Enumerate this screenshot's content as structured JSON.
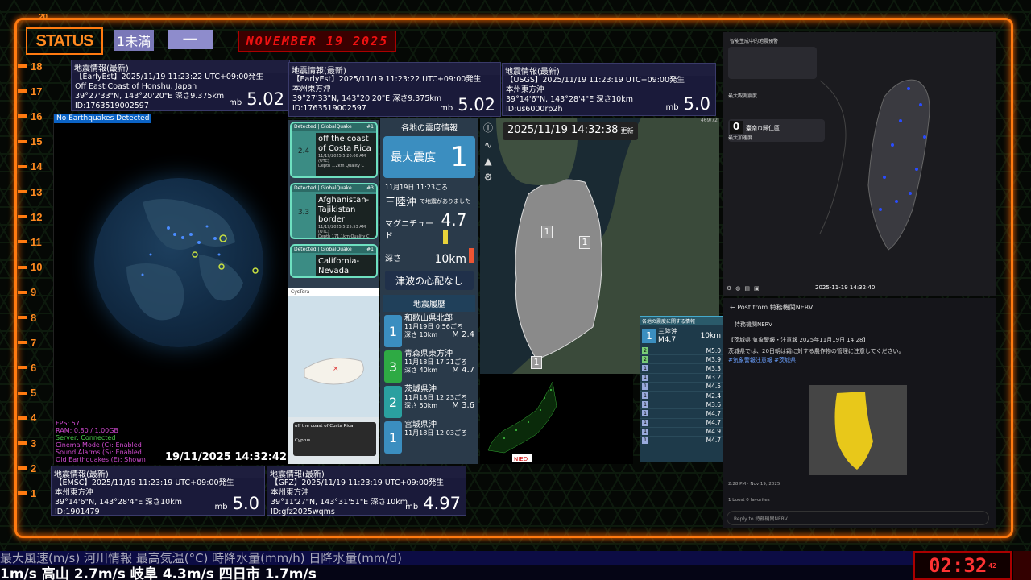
{
  "status": {
    "label": "STATUS",
    "badge_a": "1未満",
    "badge_b": "一",
    "date_banner": "NOVEMBER 19 2025"
  },
  "ruler": {
    "top_label": "20",
    "ticks": [
      "18",
      "17",
      "16",
      "15",
      "14",
      "13",
      "12",
      "11",
      "10",
      "9",
      "8",
      "7",
      "6",
      "5",
      "4",
      "3",
      "2",
      "1"
    ]
  },
  "cards": [
    {
      "id": "c1",
      "header": "地震情報(最新)",
      "l1": "【EarlyEst】2025/11/19 11:23:22 UTC+09:00発生",
      "l2": "Off East Coast of Honshu, Japan",
      "l3": "39°27'33\"N, 143°20'20\"E 深さ9.375km",
      "l4": "ID:1763519002597",
      "unit": "mb",
      "mag": "5.02"
    },
    {
      "id": "c2",
      "header": "地震情報(最新)",
      "l1": "【EarlyEst】2025/11/19 11:23:22 UTC+09:00発生",
      "l2": "本州東方沖",
      "l3": "39°27'33\"N, 143°20'20\"E 深さ9.375km",
      "l4": "ID:1763519002597",
      "unit": "mb",
      "mag": "5.02"
    },
    {
      "id": "c3",
      "header": "地震情報(最新)",
      "l1": "【USGS】2025/11/19 11:23:19 UTC+09:00発生",
      "l2": "本州東方沖",
      "l3": "39°14'6\"N, 143°28'4\"E 深さ10km",
      "l4": "ID:us6000rp2h",
      "unit": "mb",
      "mag": "5.0"
    },
    {
      "id": "c4",
      "header": "地震情報(最新)",
      "l1": "【EMSC】2025/11/19 11:23:19 UTC+09:00発生",
      "l2": "本州東方沖",
      "l3": "39°14'6\"N, 143°28'4\"E 深さ10km",
      "l4": "ID:1901479",
      "unit": "mb",
      "mag": "5.0"
    },
    {
      "id": "c5",
      "header": "地震情報(最新)",
      "l1": "【GFZ】2025/11/19 11:23:19 UTC+09:00発生",
      "l2": "本州東方沖",
      "l3": "39°11'27\"N, 143°31'51\"E 深さ10km",
      "l4": "ID:gfz2025wqms",
      "unit": "mb",
      "mag": "4.97"
    }
  ],
  "globe": {
    "no_eq": "No Earthquakes Detected",
    "clock": "19/11/2025 14:32:42",
    "stats": [
      "FPS: 57",
      "RAM: 0.80 / 1.00GB",
      "Server: Connected",
      "Cinema Mode (C): Enabled",
      "Sound Alarms (S): Enabled",
      "Old Earthquakes (E): Shown"
    ]
  },
  "globalquake": [
    {
      "tag": "Detected | GlobalQuake",
      "num": "#1",
      "name": "off the coast of Costa Rica",
      "mag": "2.4",
      "time": "11/19/2025 5:20:06 AM (UTC)",
      "meta": "Depth 1.2km Quality C"
    },
    {
      "tag": "Detected | GlobalQuake",
      "num": "#3",
      "name": "Afghanistan-Tajikistan border",
      "mag": "3.3",
      "time": "11/19/2025 5:25:53 AM (UTC)",
      "meta": "Depth 171.1km Quality C"
    },
    {
      "tag": "Detected | GlobalQuake",
      "num": "#1",
      "name": "California-Nevada",
      "mag": "",
      "time": "",
      "meta": ""
    }
  ],
  "cy_map": {
    "header": "CysTera",
    "bottom_card": "off the coast of Costa Rica",
    "bottom_card2": "Cyprus"
  },
  "shindo": {
    "header": "各地の震度情報",
    "max_label": "最大震度",
    "max_value": "1",
    "time": "11月19日 11:23ごろ",
    "place": "三陸沖",
    "place_suffix": "で地震がありました",
    "mag_label": "マグニチュード",
    "mag_value": "4.7",
    "depth_label": "深さ",
    "depth_value": "10km",
    "tsunami": "津波の心配なし",
    "history_header": "地震履歴",
    "history": [
      {
        "shindo": "1",
        "place": "和歌山県北部",
        "time": "11月19日 0:56ごろ",
        "depth": "深さ  10km",
        "mag": "M 2.4",
        "color": "#3b8ec0"
      },
      {
        "shindo": "3",
        "place": "青森県東方沖",
        "time": "11月18日 17:21ごろ",
        "depth": "深さ  40km",
        "mag": "M 4.7",
        "color": "#2eaa44"
      },
      {
        "shindo": "2",
        "place": "茨城県沖",
        "time": "11月18日 12:23ごろ",
        "depth": "深さ  50km",
        "mag": "M 3.6",
        "color": "#2aa0a0"
      },
      {
        "shindo": "1",
        "place": "宮城県沖",
        "time": "11月18日 12:03ごろ",
        "depth": "",
        "mag": "",
        "color": "#3b8ec0"
      }
    ]
  },
  "jp_map": {
    "time": "2025/11/19  14:32:38",
    "update": "更新",
    "shindo_markers": [
      "1",
      "1",
      "1"
    ],
    "corner": "469/72"
  },
  "regions": {
    "header": "各地の震度に関する情報",
    "place": "三陸沖",
    "badge": "1",
    "mag": "M4.7",
    "depth": "10km",
    "rows": [
      {
        "b": "2",
        "m": "M5.0"
      },
      {
        "b": "2",
        "m": "M3.9"
      },
      {
        "b": "1",
        "m": "M3.3"
      },
      {
        "b": "1",
        "m": "M3.2"
      },
      {
        "b": "1",
        "m": "M4.5"
      },
      {
        "b": "1",
        "m": "M2.4"
      },
      {
        "b": "1",
        "m": "M3.6"
      },
      {
        "b": "1",
        "m": "M4.7"
      },
      {
        "b": "1",
        "m": "M4.7"
      },
      {
        "b": "1",
        "m": "M4.9"
      },
      {
        "b": "1",
        "m": "M4.7"
      }
    ]
  },
  "taiwan": {
    "header": "智能生成中的地震預警",
    "city": "臺南市歸仁區",
    "max_label": "最大觀測震度",
    "value": "0",
    "sub": "最大加速度",
    "time": "2025-11-19 14:32:40"
  },
  "post": {
    "title": "Post from 特務機関NERV",
    "author": "特務機関NERV",
    "body": "【茨城県 気象警報・注意報 2025年11月19日 14:28】",
    "body2": "茨城県では、20日朝は霜に対する農作物の管理に注意してください。",
    "tags": "#気象警報注意報 #茨城県",
    "foot": "2:28 PM · Nov 19, 2025",
    "stats": "1 boost   0 favorites",
    "reply": "Reply to 特務機関NERV"
  },
  "ticker": {
    "top": "最大風速(m/s)  河川情報          最高気温(°C)          時降水量(mm/h)      日降水量(mm/d)",
    "bottom": "1m/s          高山  2.7m/s          岐阜  4.3m/s          四日市  1.7m/s"
  },
  "clock": {
    "time": "02:32",
    "sec": "42"
  }
}
